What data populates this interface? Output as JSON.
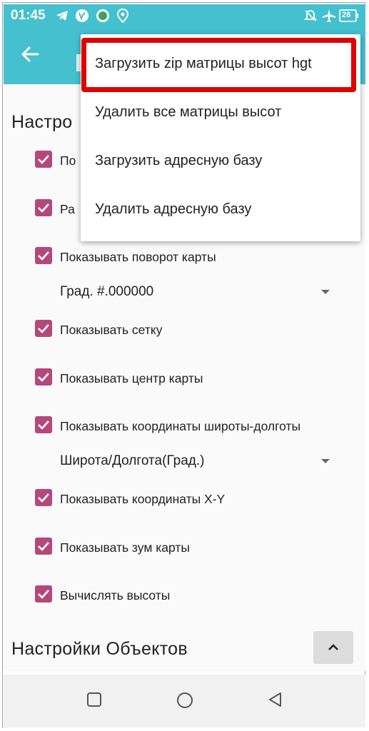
{
  "status_bar": {
    "time": "01:45",
    "battery": "28",
    "icons": [
      "telegram-icon",
      "vpn-icon",
      "app-badge-icon",
      "location-icon",
      "alarm-icon",
      "airplane-icon",
      "battery-icon"
    ]
  },
  "app_bar": {
    "back_icon": "arrow-left-icon"
  },
  "menu": {
    "items": [
      {
        "label": "Загрузить zip матрицы высот hgt"
      },
      {
        "label": "Удалить все матрицы высот"
      },
      {
        "label": "Загрузить адресную базу"
      },
      {
        "label": "Удалить адресную базу"
      }
    ],
    "highlighted_index": 0
  },
  "settings": {
    "section_title": "Настро",
    "items": [
      {
        "label": "По",
        "checked": true
      },
      {
        "label": "Ра",
        "checked": true
      },
      {
        "label": "Показывать поворот карты",
        "checked": true
      },
      {
        "label": "Показывать сетку",
        "checked": true
      },
      {
        "label": "Показывать центр карты",
        "checked": true
      },
      {
        "label": "Показывать координаты широты-долготы",
        "checked": true
      },
      {
        "label": "Показывать координаты X-Y",
        "checked": true
      },
      {
        "label": "Показывать зум карты",
        "checked": true
      },
      {
        "label": "Вычислять высоты",
        "checked": true
      }
    ],
    "rotation_format": "Град. #.000000",
    "coord_format": "Широта/Долгота(Град.)",
    "objects_title": "Настройки Объектов"
  },
  "colors": {
    "app_bar": "#45c0cf",
    "checkbox": "#b5487b",
    "highlight": "#e00000"
  }
}
